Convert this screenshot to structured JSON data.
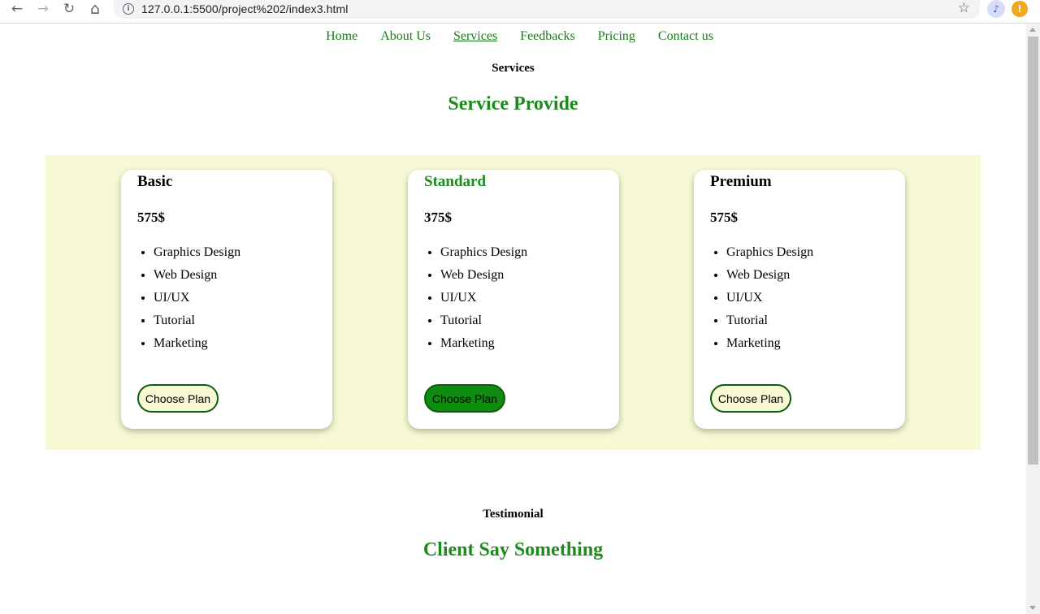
{
  "browser": {
    "url": "127.0.0.1:5500/project%202/index3.html",
    "back_icon": "←",
    "forward_icon": "→",
    "reload_icon": "↻",
    "home_icon": "⌂",
    "info_icon": "i",
    "star_icon": "☆",
    "ext_music_icon": "♪",
    "ext_alert_icon": "!"
  },
  "nav": {
    "items": [
      {
        "label": "Home",
        "active": false
      },
      {
        "label": "About Us",
        "active": false
      },
      {
        "label": "Services",
        "active": true
      },
      {
        "label": "Feedbacks",
        "active": false
      },
      {
        "label": "Pricing",
        "active": false
      },
      {
        "label": "Contact us",
        "active": false
      }
    ]
  },
  "services": {
    "tag": "Services",
    "title": "Service Provide"
  },
  "plans": [
    {
      "name": "Basic",
      "price": "575$",
      "features": [
        "Graphics Design",
        "Web Design",
        "UI/UX",
        "Tutorial",
        "Marketing"
      ],
      "button": "Choose Plan",
      "highlighted": false
    },
    {
      "name": "Standard",
      "price": "375$",
      "features": [
        "Graphics Design",
        "Web Design",
        "UI/UX",
        "Tutorial",
        "Marketing"
      ],
      "button": "Choose Plan",
      "highlighted": true
    },
    {
      "name": "Premium",
      "price": "575$",
      "features": [
        "Graphics Design",
        "Web Design",
        "UI/UX",
        "Tutorial",
        "Marketing"
      ],
      "button": "Choose Plan",
      "highlighted": false
    }
  ],
  "testimonial": {
    "tag": "Testimonial",
    "title": "Client Say Something"
  },
  "colors": {
    "accent_green": "#1c8a1c",
    "band_background": "#f7f9d5",
    "button_border": "#0d5b0d",
    "button_filled": "#0f8c0f"
  }
}
